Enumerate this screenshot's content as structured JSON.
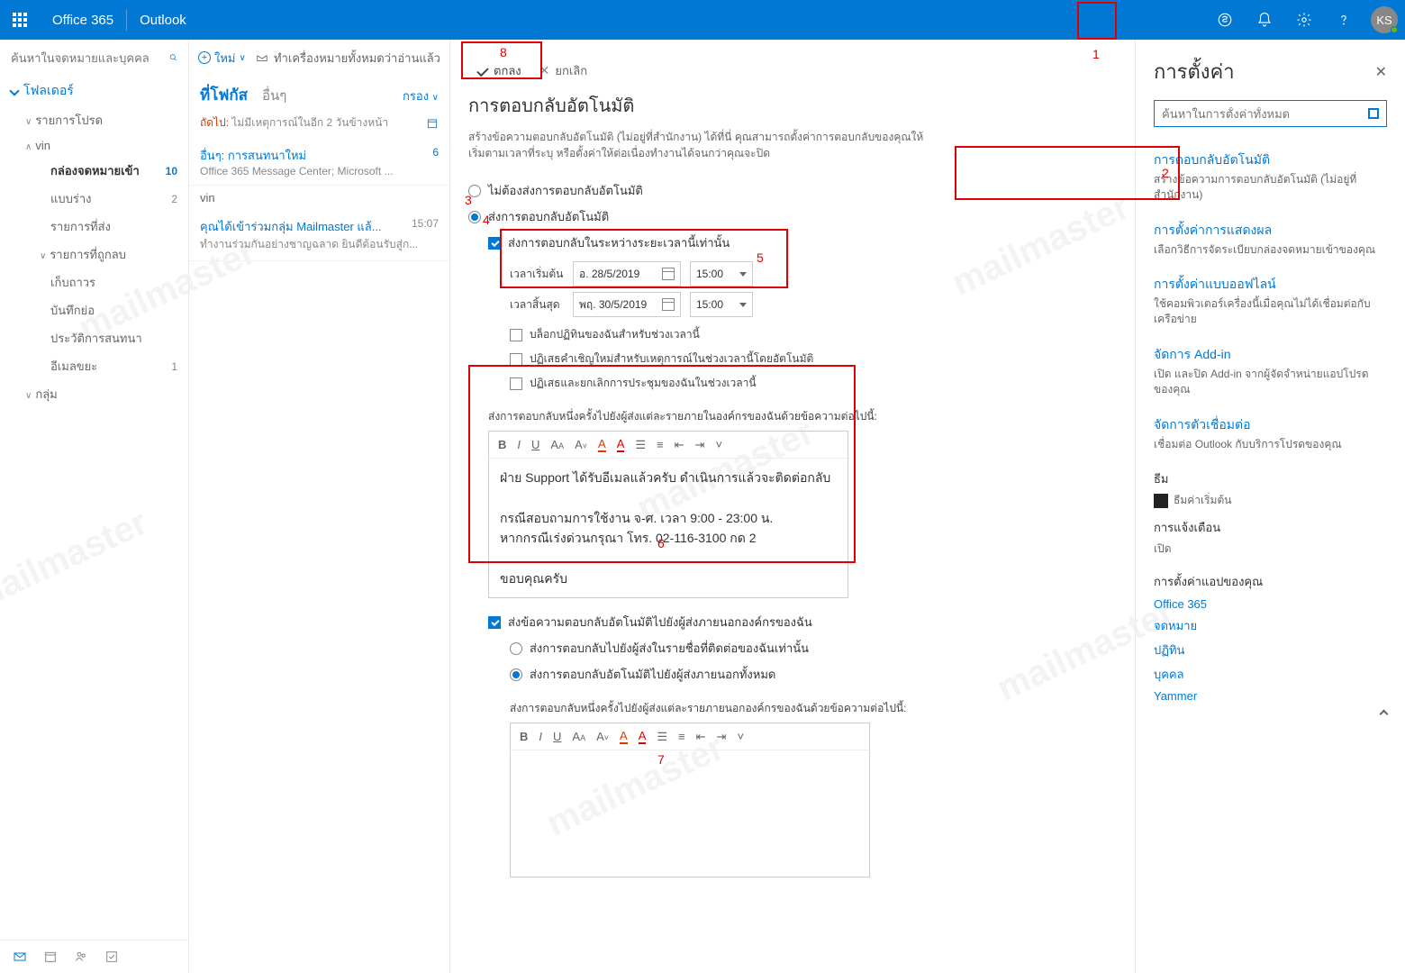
{
  "topbar": {
    "brand1": "Office 365",
    "brand2": "Outlook",
    "avatar": "KS"
  },
  "leftnav": {
    "search_placeholder": "ค้นหาในจดหมายและบุคคล",
    "folders_label": "โฟลเดอร์",
    "favorites": "รายการโปรด",
    "account": "vin",
    "inbox": "กล่องจดหมายเข้า",
    "inbox_count": "10",
    "drafts": "แบบร่าง",
    "drafts_count": "2",
    "sent": "รายการที่ส่ง",
    "deleted": "รายการที่ถูกลบ",
    "archive": "เก็บถาวร",
    "notes": "บันทึกย่อ",
    "convhistory": "ประวัติการสนทนา",
    "junk": "อีเมลขยะ",
    "junk_count": "1",
    "groups": "กลุ่ม"
  },
  "msglist": {
    "new_label": "ใหม่",
    "markread": "ทำเครื่องหมายทั้งหมดว่าอ่านแล้ว",
    "tab_focused": "ที่โฟกัส",
    "tab_other": "อื่นๆ",
    "filter": "กรอง",
    "next_label": "ถัดไป:",
    "next_text": "ไม่มีเหตุการณ์ในอีก 2 วันข้างหน้า",
    "msg1_subj": "อื่นๆ: การสนทนาใหม่",
    "msg1_prev": "Office 365 Message Center; Microsoft ...",
    "msg1_cnt": "6",
    "section": "vin",
    "msg2_subj": "คุณได้เข้าร่วมกลุ่ม Mailmaster แล้...",
    "msg2_prev": "ทำงานร่วมกันอย่างชาญฉลาด ยินดีต้อนรับสู่ก...",
    "msg2_time": "15:07"
  },
  "content": {
    "ok_label": "ตกลง",
    "cancel_label": "ยกเลิก",
    "title": "การตอบกลับอัตโนมัติ",
    "desc": "สร้างข้อความตอบกลับอัตโนมัติ (ไม่อยู่ที่สำนักงาน) ได้ที่นี่ คุณสามารถตั้งค่าการตอบกลับของคุณให้เริ่มตามเวลาที่ระบุ หรือตั้งค่าให้ต่อเนื่องทำงานได้จนกว่าคุณจะปิด",
    "radio_off": "ไม่ต้องส่งการตอบกลับอัตโนมัติ",
    "radio_on": "ส่งการตอบกลับอัตโนมัติ",
    "cb_period": "ส่งการตอบกลับในระหว่างระยะเวลานี้เท่านั้น",
    "start_label": "เวลาเริ่มต้น",
    "start_date": "อ. 28/5/2019",
    "start_time": "15:00",
    "end_label": "เวลาสิ้นสุด",
    "end_date": "พฤ. 30/5/2019",
    "end_time": "15:00",
    "opt_block": "บล็อกปฏิทินของฉันสำหรับช่วงเวลานี้",
    "opt_decline": "ปฏิเสธคำเชิญใหม่สำหรับเหตุการณ์ในช่วงเวลานี้โดยอัตโนมัติ",
    "opt_cancel": "ปฏิเสธและยกเลิกการประชุมของฉันในช่วงเวลานี้",
    "editor1_label": "ส่งการตอบกลับหนึ่งครั้งไปยังผู้ส่งแต่ละรายภายในองค์กรของฉันด้วยข้อความต่อไปนี้:",
    "editor1_line1": "ฝ่าย Support ได้รับอีเมลแล้วครับ ดำเนินการแล้วจะติดต่อกลับ",
    "editor1_line2": "กรณีสอบถามการใช้งาน จ-ศ. เวลา 9:00 - 23:00 น.",
    "editor1_line3": "หากกรณีเร่งด่วนกรุณา โทร. 02-116-3100 กด 2",
    "editor1_line4": "ขอบคุณครับ",
    "cb_external": "ส่งข้อความตอบกลับอัตโนมัติไปยังผู้ส่งภายนอกองค์กรของฉัน",
    "ext_contacts": "ส่งการตอบกลับไปยังผู้ส่งในรายชื่อที่ติดต่อของฉันเท่านั้น",
    "ext_all": "ส่งการตอบกลับอัตโนมัติไปยังผู้ส่งภายนอกทั้งหมด",
    "editor2_label": "ส่งการตอบกลับหนึ่งครั้งไปยังผู้ส่งแต่ละรายภายนอกองค์กรของฉันด้วยข้อความต่อไปนี้:"
  },
  "settings": {
    "title": "การตั้งค่า",
    "search_placeholder": "ค้นหาในการตั้งค่าทั้งหมด",
    "auto_title": "การตอบกลับอัตโนมัติ",
    "auto_sub": "สร้างข้อความการตอบกลับอัตโนมัติ (ไม่อยู่ที่สำนักงาน)",
    "display_title": "การตั้งค่าการแสดงผล",
    "display_sub": "เลือกวิธีการจัดระเบียบกล่องจดหมายเข้าของคุณ",
    "offline_title": "การตั้งค่าแบบออฟไลน์",
    "offline_sub": "ใช้คอมพิวเตอร์เครื่องนี้เมื่อคุณไม่ได้เชื่อมต่อกับเครือข่าย",
    "addin_title": "จัดการ Add-in",
    "addin_sub": "เปิด และปิด Add-in จากผู้จัดจำหน่ายแอปโปรดของคุณ",
    "conn_title": "จัดการตัวเชื่อมต่อ",
    "conn_sub": "เชื่อมต่อ Outlook กับบริการโปรดของคุณ",
    "theme_label": "ธีม",
    "theme_value": "ธีมค่าเริ่มต้น",
    "notif_label": "การแจ้งเตือน",
    "notif_value": "เปิด",
    "apps_label": "การตั้งค่าแอปของคุณ",
    "link1": "Office 365",
    "link2": "จดหมาย",
    "link3": "ปฏิทิน",
    "link4": "บุคคล",
    "link5": "Yammer"
  },
  "anno": {
    "l1": "1",
    "l2": "2",
    "l3": "3",
    "l4": "4",
    "l5": "5",
    "l6": "6",
    "l7": "7",
    "l8": "8"
  }
}
